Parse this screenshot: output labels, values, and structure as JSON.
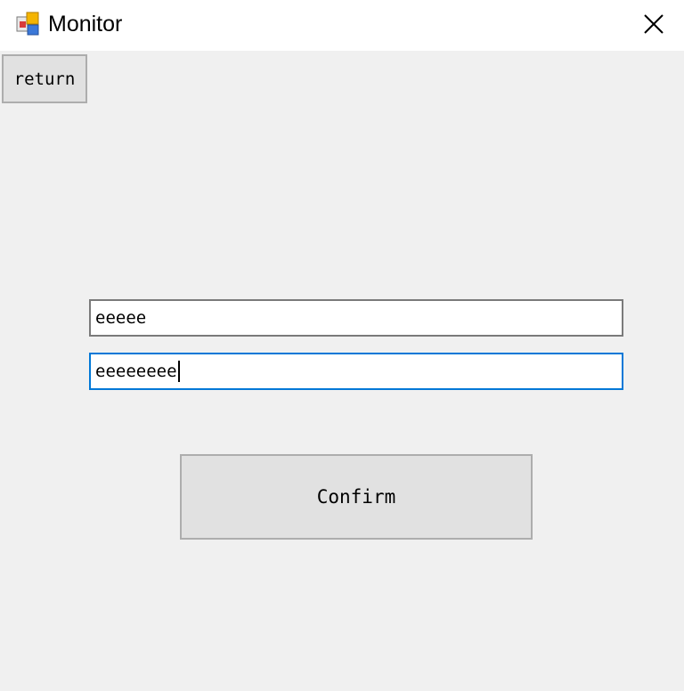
{
  "window": {
    "title": "Monitor",
    "icon": "app-window-icon",
    "close_icon": "close-icon"
  },
  "toolbar": {
    "return_label": "return"
  },
  "form": {
    "field_1_value": "eeeee",
    "field_2_value": "eeeeeeee",
    "confirm_label": "Confirm"
  },
  "colors": {
    "background": "#f0f0f0",
    "titlebar": "#ffffff",
    "button_face": "#e1e1e1",
    "button_border": "#adadad",
    "focus_border": "#0078d7"
  }
}
